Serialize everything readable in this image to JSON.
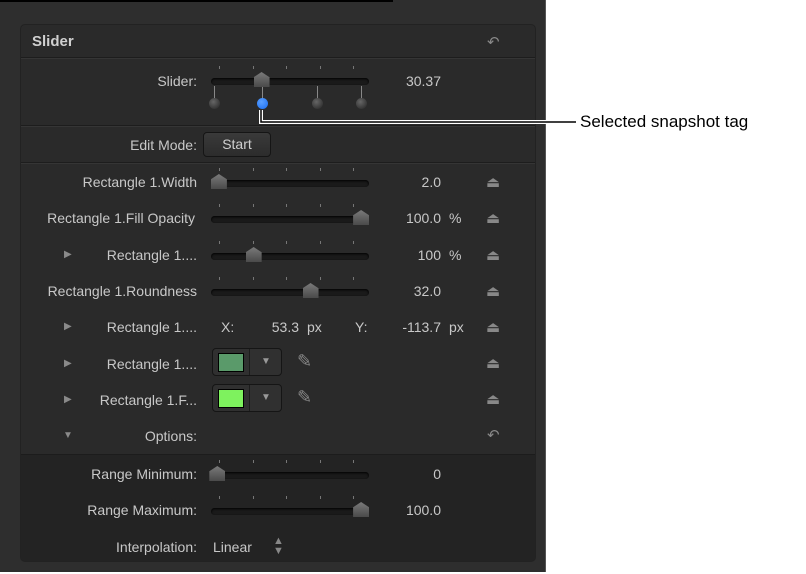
{
  "panel": {
    "title": "Slider"
  },
  "slider": {
    "label": "Slider:",
    "value": "30.37",
    "fraction": 0.32,
    "tags": [
      0.02,
      0.32,
      0.67,
      0.95
    ],
    "selected_tag": 1
  },
  "edit_mode": {
    "label": "Edit Mode:",
    "button": "Start"
  },
  "rows": [
    {
      "label": "Rectangle 1.Width",
      "value": "2.0",
      "unit": "",
      "fraction": 0.05
    },
    {
      "label": "Rectangle 1.Fill Opacity",
      "value": "100.0",
      "unit": "%",
      "fraction": 0.95
    },
    {
      "label": "Rectangle 1....",
      "value": "100",
      "unit": "%",
      "fraction": 0.27
    },
    {
      "label": "Rectangle 1.Roundness",
      "value": "32.0",
      "unit": "",
      "fraction": 0.63
    },
    {
      "label": "Rectangle 1....",
      "x_label": "X:",
      "x_value": "53.3",
      "x_unit": "px",
      "y_label": "Y:",
      "y_value": "-113.7",
      "y_unit": "px"
    },
    {
      "label": "Rectangle 1....",
      "color": "#5a9a6a"
    },
    {
      "label": "Rectangle 1.F...",
      "color": "#7ef25e"
    }
  ],
  "options": {
    "label": "Options:",
    "range_min": {
      "label": "Range Minimum:",
      "value": "0",
      "fraction": 0.04
    },
    "range_max": {
      "label": "Range Maximum:",
      "value": "100.0",
      "fraction": 0.95
    },
    "interpolation": {
      "label": "Interpolation:",
      "value": "Linear"
    }
  },
  "annotation": "Selected snapshot tag",
  "colors": {
    "selected_tag": "#1a6cf0"
  }
}
